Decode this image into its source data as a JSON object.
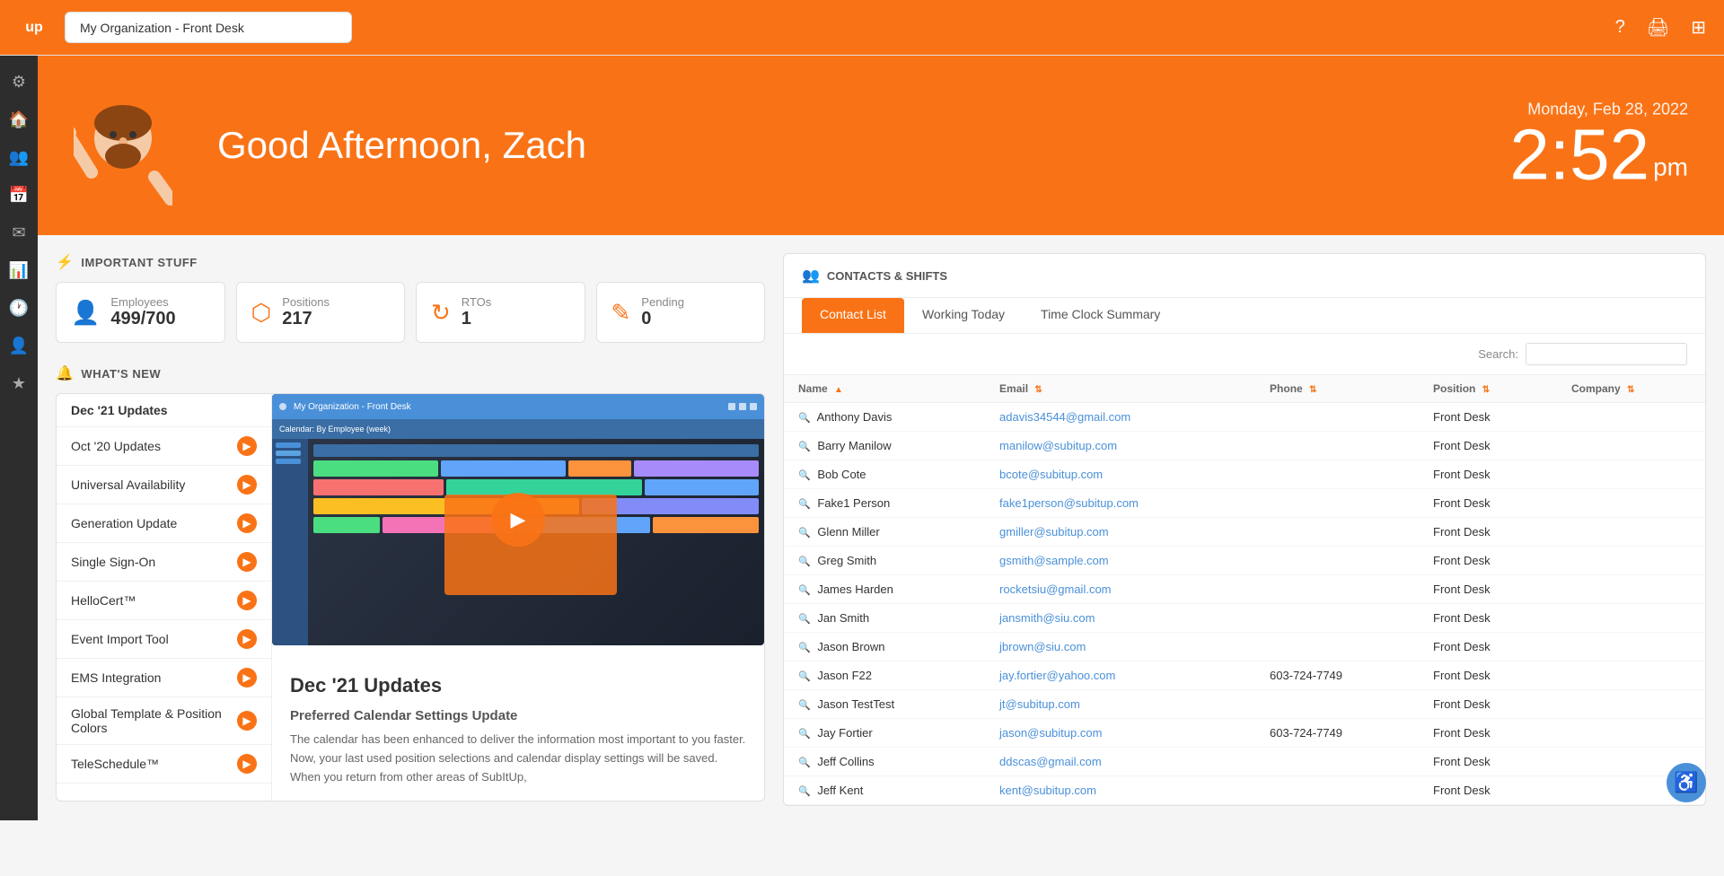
{
  "topbar": {
    "logo": "up",
    "org_selector_label": "My Organization - Front Desk",
    "org_selector_arrow": "▾",
    "icons": [
      "?",
      "🖨",
      "⊞"
    ]
  },
  "sidebar": {
    "items": [
      {
        "name": "settings",
        "icon": "⚙"
      },
      {
        "name": "home",
        "icon": "🏠"
      },
      {
        "name": "team",
        "icon": "👥"
      },
      {
        "name": "calendar",
        "icon": "📅"
      },
      {
        "name": "mail",
        "icon": "✉"
      },
      {
        "name": "chart",
        "icon": "📊"
      },
      {
        "name": "clock",
        "icon": "🕐"
      },
      {
        "name": "person",
        "icon": "👤"
      },
      {
        "name": "star",
        "icon": "★"
      }
    ]
  },
  "hero": {
    "greeting": "Good Afternoon, Zach",
    "date": "Monday, Feb 28, 2022",
    "time": "2:52",
    "ampm": "pm"
  },
  "important_stuff": {
    "section_title": "IMPORTANT STUFF",
    "stats": [
      {
        "label": "Employees",
        "value": "499/700",
        "icon": "👤"
      },
      {
        "label": "Positions",
        "value": "217",
        "icon": "⬡"
      },
      {
        "label": "RTOs",
        "value": "1",
        "icon": "↻"
      },
      {
        "label": "Pending",
        "value": "0",
        "icon": "✎"
      }
    ]
  },
  "whats_new": {
    "section_title": "WHAT'S NEW",
    "items": [
      {
        "label": "Dec '21 Updates",
        "active": true
      },
      {
        "label": "Oct '20 Updates",
        "active": false
      },
      {
        "label": "Universal Availability",
        "active": false
      },
      {
        "label": "Generation Update",
        "active": false
      },
      {
        "label": "Single Sign-On",
        "active": false
      },
      {
        "label": "HelloCert™",
        "active": false
      },
      {
        "label": "Event Import Tool",
        "active": false
      },
      {
        "label": "EMS Integration",
        "active": false
      },
      {
        "label": "Global Template & Position Colors",
        "active": false
      },
      {
        "label": "TeleSchedule™",
        "active": false
      }
    ],
    "active_item": {
      "title": "Dec '21 Updates",
      "subtitle": "Preferred Calendar Settings Update",
      "body": "The calendar has been enhanced to deliver the information most important to you faster. Now, your last used position selections and calendar display settings will be saved. When you return from other areas of SubItUp,"
    }
  },
  "contacts": {
    "section_title": "CONTACTS & SHIFTS",
    "tabs": [
      {
        "label": "Contact List",
        "active": true
      },
      {
        "label": "Working Today",
        "active": false
      },
      {
        "label": "Time Clock Summary",
        "active": false
      }
    ],
    "search_label": "Search:",
    "search_placeholder": "",
    "table": {
      "headers": [
        "Name",
        "Email",
        "Phone",
        "Position",
        "Company"
      ],
      "rows": [
        {
          "name": "Anthony Davis",
          "email": "adavis34544@gmail.com",
          "phone": "",
          "position": "Front Desk",
          "company": ""
        },
        {
          "name": "Barry Manilow",
          "email": "manilow@subitup.com",
          "phone": "",
          "position": "Front Desk",
          "company": ""
        },
        {
          "name": "Bob Cote",
          "email": "bcote@subitup.com",
          "phone": "",
          "position": "Front Desk",
          "company": ""
        },
        {
          "name": "Fake1 Person",
          "email": "fake1person@subitup.com",
          "phone": "",
          "position": "Front Desk",
          "company": ""
        },
        {
          "name": "Glenn Miller",
          "email": "gmiller@subitup.com",
          "phone": "",
          "position": "Front Desk",
          "company": ""
        },
        {
          "name": "Greg Smith",
          "email": "gsmith@sample.com",
          "phone": "",
          "position": "Front Desk",
          "company": ""
        },
        {
          "name": "James Harden",
          "email": "rocketsiu@gmail.com",
          "phone": "",
          "position": "Front Desk",
          "company": ""
        },
        {
          "name": "Jan Smith",
          "email": "jansmith@siu.com",
          "phone": "",
          "position": "Front Desk",
          "company": ""
        },
        {
          "name": "Jason Brown",
          "email": "jbrown@siu.com",
          "phone": "",
          "position": "Front Desk",
          "company": ""
        },
        {
          "name": "Jason F22",
          "email": "jay.fortier@yahoo.com",
          "phone": "603-724-7749",
          "position": "Front Desk",
          "company": ""
        },
        {
          "name": "Jason TestTest",
          "email": "jt@subitup.com",
          "phone": "",
          "position": "Front Desk",
          "company": ""
        },
        {
          "name": "Jay Fortier",
          "email": "jason@subitup.com",
          "phone": "603-724-7749",
          "position": "Front Desk",
          "company": ""
        },
        {
          "name": "Jeff Collins",
          "email": "ddscas@gmail.com",
          "phone": "",
          "position": "Front Desk",
          "company": ""
        },
        {
          "name": "Jeff Kent",
          "email": "kent@subitup.com",
          "phone": "",
          "position": "Front Desk",
          "company": ""
        }
      ]
    }
  },
  "accessibility": {
    "icon": "♿"
  }
}
